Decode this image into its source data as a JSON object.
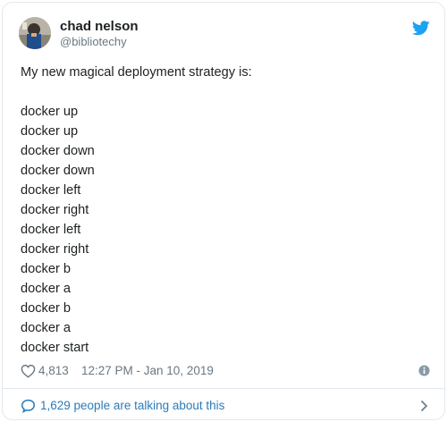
{
  "author": {
    "display_name": "chad nelson",
    "handle": "@bibliotechy"
  },
  "tweet": {
    "intro": "My new magical deployment strategy is:",
    "lines": [
      "docker up",
      "docker up",
      "docker down",
      "docker down",
      "docker left",
      "docker right",
      "docker left",
      "docker right",
      "docker b",
      "docker a",
      "docker b",
      "docker a",
      "docker start"
    ]
  },
  "meta": {
    "likes": "4,813",
    "timestamp": "12:27 PM - Jan 10, 2019"
  },
  "footer": {
    "conversation_label": "1,629 people are talking about this"
  },
  "icons": {
    "brand": "twitter-bird-icon",
    "like": "heart-icon",
    "info": "info-icon",
    "conversation": "speech-bubble-icon",
    "chevron": "chevron-right-icon"
  },
  "colors": {
    "twitter_blue": "#1da1f2",
    "link_blue": "#2b7bb9",
    "secondary_text": "#697882",
    "primary_text": "#1c2022",
    "border": "#e1e8ed"
  }
}
